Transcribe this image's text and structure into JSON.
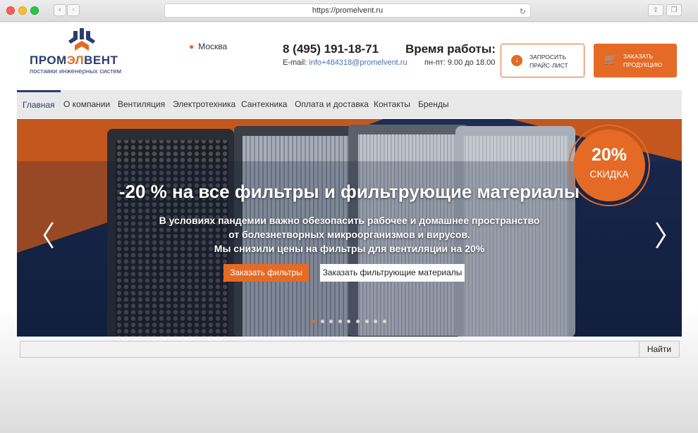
{
  "browser": {
    "url": "https://promelvent.ru",
    "back_icon": "‹",
    "forward_icon": "›",
    "reload_icon": "↻",
    "share_icon": "⇪",
    "tabs_icon": "❐"
  },
  "header": {
    "logo_pre": "ПРОМ",
    "logo_acc": "ЭЛ",
    "logo_post": "ВЕНТ",
    "logo_sub": "поставки инженерных систем",
    "city": "Москва",
    "phone": "8 (495) 191-18-71",
    "email_label": "E-mail:",
    "email": "info+484318@promelvent.ru",
    "hours_title": "Время работы:",
    "hours": "пн-пт: 9.00 до 18.00",
    "price_button": "ЗАПРОСИТЬ ПРАЙС-ЛИСТ",
    "order_button": "ЗАКАЗАТЬ ПРОДУКЦИЮ"
  },
  "nav": {
    "items": [
      {
        "label": "Главная"
      },
      {
        "label": "О компании"
      },
      {
        "label": "Вентиляция"
      },
      {
        "label": "Электротехника"
      },
      {
        "label": "Сантехника"
      },
      {
        "label": "Оплата и доставка"
      },
      {
        "label": "Контакты"
      },
      {
        "label": "Бренды"
      }
    ]
  },
  "hero": {
    "title": "-20 % на все фильтры и фильтрующие материалы",
    "line1": "В условиях пандемии важно обезопасить рабочее и домашнее пространство",
    "line2": "от болезнетворных микроорганизмов и вирусов.",
    "line3": "Мы снизили цены на фильтры для вентиляции на 20%",
    "button1": "Заказать фильтры",
    "button2": "Заказать фильтрующие материалы",
    "badge_percent": "20%",
    "badge_label": "СКИДКА",
    "prev_icon": "〈",
    "next_icon": "〉",
    "slide_count": 9,
    "active_slide": 1
  },
  "search": {
    "value": "",
    "button": "Найти"
  },
  "colors": {
    "accent": "#e56a25",
    "brand": "#2a3f6e"
  }
}
